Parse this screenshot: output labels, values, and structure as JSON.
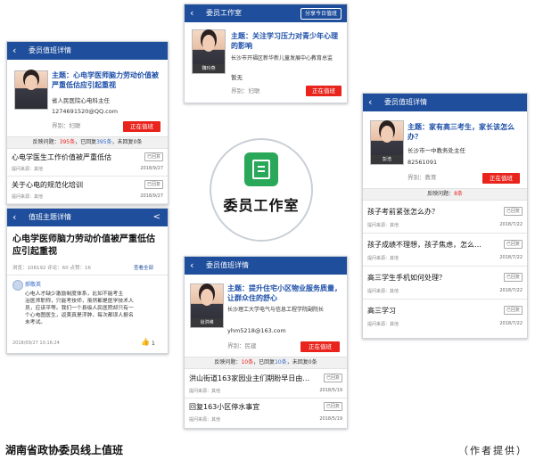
{
  "colors": {
    "header_blue": "#1f4e9c",
    "accent_red": "#e8241c",
    "topic_blue": "#1d4fa8",
    "logo_green": "#2aa85a"
  },
  "center_logo": {
    "label": "委员工作室",
    "icon": "document-seal-icon"
  },
  "caption": "湖南省政协委员线上值班",
  "credit": "（作者提供）",
  "phone_top": {
    "title": "委员工作室",
    "share_button": "分享今日值班",
    "member_tag": "魏玲燕",
    "topic": "主题：关注学习压力对青少年心理的影响",
    "org": "长沙市开福区新华新儿童发展中心教育总监",
    "empty_note": "暂无",
    "sector": "界别：妇联",
    "duty_button": "正在值班"
  },
  "phone_left": {
    "title": "委员值班详情",
    "topic": "主题：心电学医师脑力劳动价值被严重低估应引起重视",
    "org": "省人民医院心电科主任",
    "email": "1274691520@QQ.com",
    "sector": "界别：妇联",
    "duty_button": "正在值班",
    "stats": {
      "label1": "反映问题：",
      "v1": "395条",
      "label2": "，已回复",
      "v2": "395条",
      "label3": "，未回复",
      "v3": "0条"
    },
    "items": [
      {
        "title": "心电学医生工作价值被严重低估",
        "meta": "提问来源：其他",
        "date": "2018/9/27",
        "tag": "已回复"
      },
      {
        "title": "关于心电的规范化培训",
        "meta": "提问来源：其他",
        "date": "2018/9/27",
        "tag": "已回复"
      }
    ]
  },
  "phone_detail": {
    "title": "值班主题详情",
    "share": "<",
    "headline": "心电学医师脑力劳动价值被严重低估应引起重视",
    "meta": "浏览：108192  评论：60  点赞：16",
    "view_all": "查看全部",
    "commenter": "郝敬英",
    "comment": [
      "心电人才缺少激励制度体系，比如不能考主",
      "治医师职称，只能考技师，虽然都是医学技术人",
      "员，应该平等。我们一个县级人民医院却只有一",
      "个心电图医生，返美真是浮肿，每次都误人报名",
      "未考试。"
    ],
    "timestamp": "2018/09/27 10:16:24",
    "likes": "1"
  },
  "phone_right": {
    "title": "委员值班详情",
    "topic": "主题：家有高三考生，家长该怎么办？",
    "org": "长沙市一中教务处主任",
    "phone": "82561091",
    "member_tag": "彭浩",
    "sector": "界别：教育",
    "duty_button": "正在值班",
    "stats": {
      "label1": "反映问题：",
      "v1": "8条"
    },
    "items": [
      {
        "title": "孩子考前紧张怎么办？",
        "meta": "提问来源：其他",
        "date": "2018/7/22",
        "tag": "已回复"
      },
      {
        "title": "孩子成绩不理想，孩子焦虑，怎么…",
        "meta": "提问来源：其他",
        "date": "2018/7/22",
        "tag": "已回复"
      },
      {
        "title": "高三学生手机如何处理？",
        "meta": "提问来源：其他",
        "date": "2018/7/22",
        "tag": "已回复"
      },
      {
        "title": "高三学习",
        "meta": "提问来源：其他",
        "date": "2018/7/22",
        "tag": "已回复"
      }
    ]
  },
  "phone_bottom": {
    "title": "委员值班详情",
    "member_tag": "肖洪维",
    "topic": "主题：提升住宅小区物业服务质量，让群众住的舒心",
    "org": "长沙理工大学电气与信息工程学院副院长",
    "email": "yhm5218@163.com",
    "sector": "界别：民建",
    "duty_button": "正在值班",
    "stats": {
      "label1": "反映问题：",
      "v1": "10条",
      "label2": "，已回复",
      "v2": "10条",
      "label3": "，未回复",
      "v3": "0条"
    },
    "items": [
      {
        "title": "洪山街道163家园业主们期盼早日由…",
        "meta": "提问来源：其他",
        "date": "2018/5/19",
        "tag": "已回复"
      },
      {
        "title": "回复163小区停水事宜",
        "meta": "提问来源：其他",
        "date": "2018/5/19",
        "tag": "已回复"
      }
    ]
  }
}
